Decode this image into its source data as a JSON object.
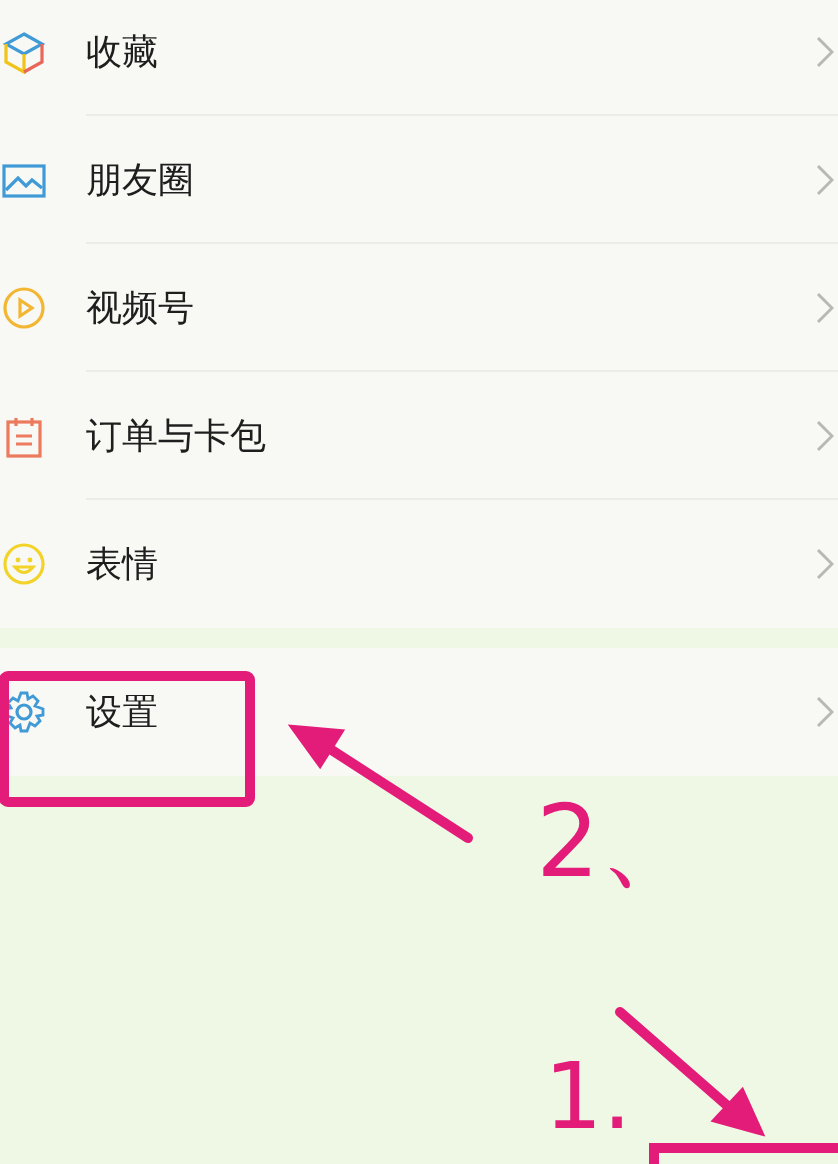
{
  "groups": [
    {
      "items": [
        {
          "label": "收藏"
        },
        {
          "label": "朋友圈"
        },
        {
          "label": "视频号"
        },
        {
          "label": "订单与卡包"
        },
        {
          "label": "表情"
        }
      ]
    },
    {
      "items": [
        {
          "label": "设置"
        }
      ]
    }
  ],
  "annotations": [
    {
      "text": "2、"
    },
    {
      "text": "1."
    }
  ]
}
